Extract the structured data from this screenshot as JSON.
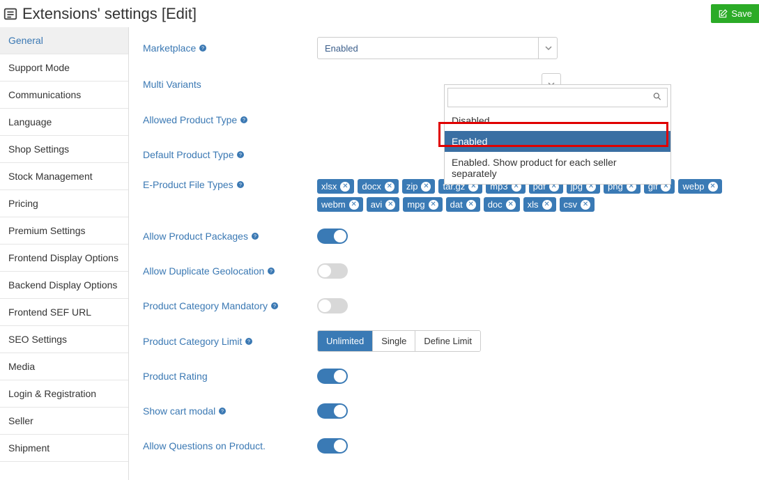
{
  "header": {
    "title": "Extensions' settings [Edit]",
    "save_label": "Save"
  },
  "sidebar": {
    "items": [
      "General",
      "Support Mode",
      "Communications",
      "Language",
      "Shop Settings",
      "Stock Management",
      "Pricing",
      "Premium Settings",
      "Frontend Display Options",
      "Backend Display Options",
      "Frontend SEF URL",
      "SEO Settings",
      "Media",
      "Login & Registration",
      "Seller",
      "Shipment"
    ],
    "active_index": 0
  },
  "form": {
    "marketplace": {
      "label": "Marketplace",
      "value": "Enabled"
    },
    "multi_variants": {
      "label": "Multi Variants"
    },
    "allowed_product_type": {
      "label": "Allowed Product Type"
    },
    "default_product_type": {
      "label": "Default Product Type"
    },
    "eproduct_file_types": {
      "label": "E-Product File Types",
      "tags": [
        "xlsx",
        "docx",
        "zip",
        "tar.gz",
        "mp3",
        "pdf",
        "jpg",
        "png",
        "gif",
        "webp",
        "webm",
        "avi",
        "mpg",
        "dat",
        "doc",
        "xls",
        "csv"
      ]
    },
    "allow_product_packages": {
      "label": "Allow Product Packages",
      "value": true
    },
    "allow_duplicate_geolocation": {
      "label": "Allow Duplicate Geolocation",
      "value": false
    },
    "product_category_mandatory": {
      "label": "Product Category Mandatory",
      "value": false
    },
    "product_category_limit": {
      "label": "Product Category Limit",
      "options": [
        "Unlimited",
        "Single",
        "Define Limit"
      ],
      "selected_index": 0
    },
    "product_rating": {
      "label": "Product Rating",
      "value": true
    },
    "show_cart_modal": {
      "label": "Show cart modal",
      "value": true
    },
    "allow_questions_on_product": {
      "label": "Allow Questions on Product.",
      "value": true
    }
  },
  "dropdown": {
    "options": [
      "Disabled",
      "Enabled",
      "Enabled. Show product for each seller separately"
    ],
    "selected_index": 1
  }
}
